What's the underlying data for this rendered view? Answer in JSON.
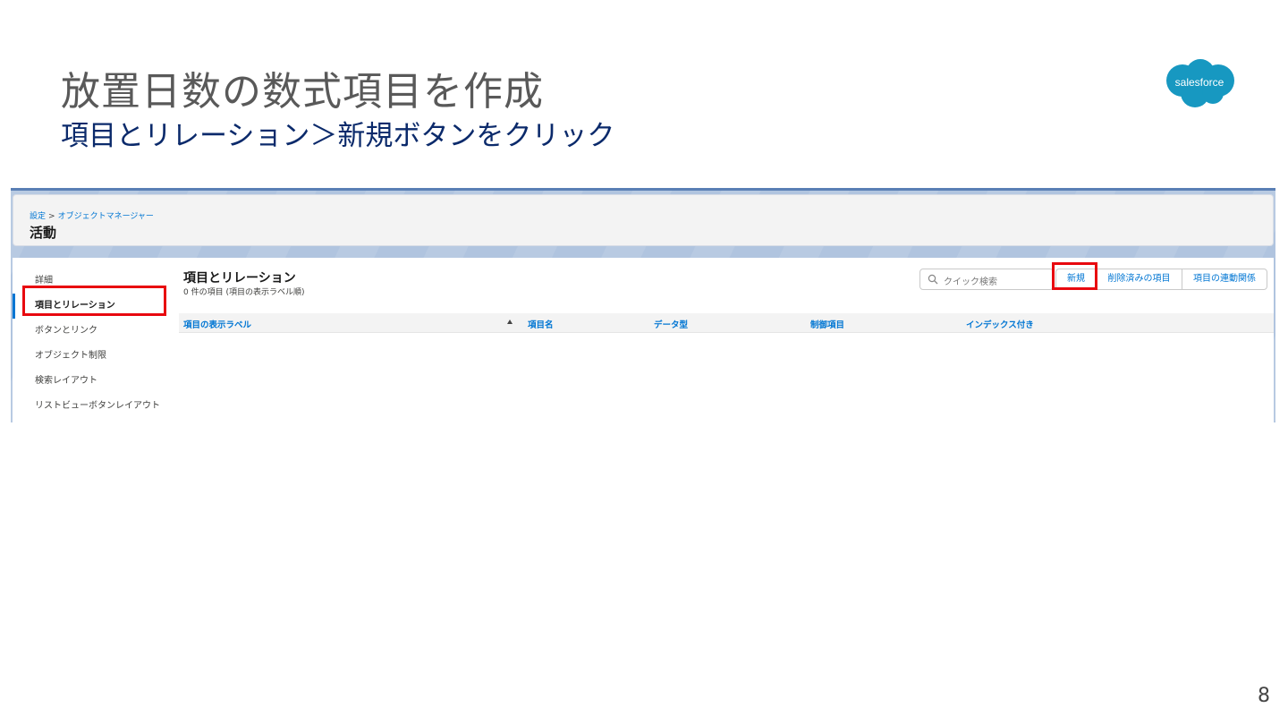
{
  "slide": {
    "title": "放置日数の数式項目を作成",
    "subtitle": "項目とリレーション＞新規ボタンをクリック",
    "page_number": "8",
    "logo_text": "salesforce",
    "logo_color": "#1798c1"
  },
  "screen": {
    "breadcrumb": {
      "items": [
        "設定",
        "オブジェクトマネージャー"
      ],
      "separator": ">"
    },
    "object_title": "活動",
    "sidebar": {
      "items": [
        {
          "label": "詳細",
          "active": false
        },
        {
          "label": "項目とリレーション",
          "active": true
        },
        {
          "label": "ボタンとリンク",
          "active": false
        },
        {
          "label": "オブジェクト制限",
          "active": false
        },
        {
          "label": "検索レイアウト",
          "active": false
        },
        {
          "label": "リストビューボタンレイアウト",
          "active": false
        }
      ]
    },
    "main": {
      "title": "項目とリレーション",
      "subtitle": "0 件の項目 (項目の表示ラベル順)",
      "search": {
        "placeholder": "クイック検索",
        "icon": "search-icon"
      },
      "buttons": {
        "new": "新規",
        "deleted_fields": "削除済みの項目",
        "field_dependencies": "項目の連動関係"
      },
      "table": {
        "columns": [
          "項目の表示ラベル",
          "項目名",
          "データ型",
          "制御項目",
          "インデックス付き"
        ],
        "sort_column": "項目の表示ラベル",
        "sort_direction": "ascending",
        "rows": []
      }
    },
    "highlight_color": "#e8090f"
  }
}
